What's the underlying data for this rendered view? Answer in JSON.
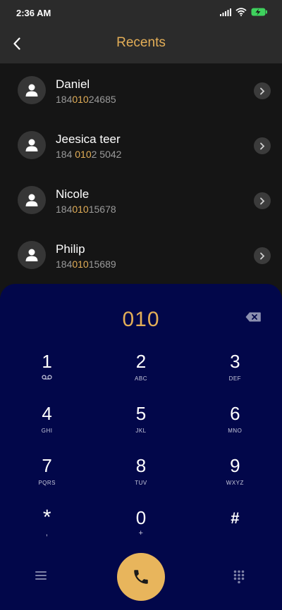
{
  "status_bar": {
    "time": "2:36 AM"
  },
  "header": {
    "title": "Recents"
  },
  "contacts": [
    {
      "name": "Daniel",
      "number_pre": "184",
      "number_hl": "010",
      "number_post": "24685"
    },
    {
      "name": "Jeesica teer",
      "number_pre": "184 ",
      "number_hl": "010",
      "number_post": "2 5042"
    },
    {
      "name": "Nicole",
      "number_pre": "184",
      "number_hl": "010",
      "number_post": "15678"
    },
    {
      "name": "Philip",
      "number_pre": "184",
      "number_hl": "010",
      "number_post": "15689"
    }
  ],
  "dialer": {
    "input": "010",
    "keys": [
      {
        "digit": "1",
        "sub": ""
      },
      {
        "digit": "2",
        "sub": "ABC"
      },
      {
        "digit": "3",
        "sub": "DEF"
      },
      {
        "digit": "4",
        "sub": "GHI"
      },
      {
        "digit": "5",
        "sub": "JKL"
      },
      {
        "digit": "6",
        "sub": "MNO"
      },
      {
        "digit": "7",
        "sub": "PQRS"
      },
      {
        "digit": "8",
        "sub": "TUV"
      },
      {
        "digit": "9",
        "sub": "WXYZ"
      },
      {
        "digit": "*",
        "sub": ","
      },
      {
        "digit": "0",
        "sub": "+"
      },
      {
        "digit": "#",
        "sub": ""
      }
    ]
  },
  "colors": {
    "accent": "#e3ae57",
    "dialer_bg": "#02074a",
    "list_bg": "#151515",
    "header_bg": "#2b2b2b",
    "call_button": "#e8b55c"
  },
  "icons": {
    "back": "chevron-left-icon",
    "avatar": "person-icon",
    "row_action": "chevron-right-icon",
    "backspace": "backspace-icon",
    "voicemail": "voicemail-icon",
    "menu": "menu-icon",
    "call": "phone-icon",
    "keypad": "dialpad-icon"
  }
}
